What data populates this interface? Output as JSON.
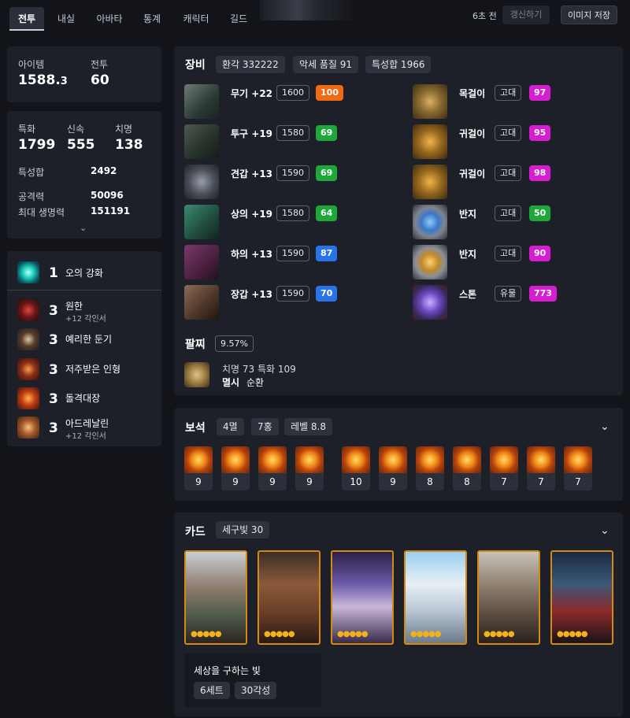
{
  "tabs": [
    "전투",
    "내실",
    "아바타",
    "통계",
    "캐릭터",
    "길드"
  ],
  "header": {
    "ago": "6초 전",
    "refresh": "갱신하기",
    "save": "이미지 저장"
  },
  "summary": {
    "item_label": "아이템",
    "item_level_main": "1588.",
    "item_level_sub": "3",
    "power_label": "전투",
    "power": "60"
  },
  "stats": {
    "crit_label": "특화",
    "crit": "1799",
    "swift_label": "신속",
    "swift": "555",
    "critical_label": "치명",
    "critical": "138",
    "total_label": "특성합",
    "total": "2492",
    "atk_label": "공격력",
    "atk": "50096",
    "hp_label": "최대 생명력",
    "hp": "151191"
  },
  "engravings": [
    {
      "level": "1",
      "name": "오의 강화",
      "sub": ""
    },
    {
      "level": "3",
      "name": "원한",
      "sub": "+12 각인서"
    },
    {
      "level": "3",
      "name": "예리한 둔기",
      "sub": ""
    },
    {
      "level": "3",
      "name": "저주받은 인형",
      "sub": ""
    },
    {
      "level": "3",
      "name": "돌격대장",
      "sub": ""
    },
    {
      "level": "3",
      "name": "아드레날린",
      "sub": "+12 각인서"
    }
  ],
  "equipment": {
    "title": "장비",
    "chips": [
      "환각 332222",
      "악세 품질 91",
      "특성합 1966"
    ],
    "left": [
      {
        "name": "무기 +22",
        "level": "1600",
        "quality": "100"
      },
      {
        "name": "투구 +19",
        "level": "1580",
        "quality": "69"
      },
      {
        "name": "견갑 +13",
        "level": "1590",
        "quality": "69"
      },
      {
        "name": "상의 +19",
        "level": "1580",
        "quality": "64"
      },
      {
        "name": "하의 +13",
        "level": "1590",
        "quality": "87"
      },
      {
        "name": "장갑 +13",
        "level": "1590",
        "quality": "70"
      }
    ],
    "right": [
      {
        "name": "목걸이",
        "grade": "고대",
        "quality": "97"
      },
      {
        "name": "귀걸이",
        "grade": "고대",
        "quality": "95"
      },
      {
        "name": "귀걸이",
        "grade": "고대",
        "quality": "98"
      },
      {
        "name": "반지",
        "grade": "고대",
        "quality": "50"
      },
      {
        "name": "반지",
        "grade": "고대",
        "quality": "90"
      },
      {
        "name": "스톤",
        "grade": "유물",
        "quality": "773"
      }
    ],
    "bracelet_label": "팔찌",
    "bracelet_pct": "9.57%",
    "bracelet_line1": "치명 73  특화 109",
    "bracelet_line2_a": "멸시",
    "bracelet_line2_b": "순환"
  },
  "gems": {
    "title": "보석",
    "chips": [
      "4멸",
      "7홍",
      "레벨 8.8"
    ],
    "levels": [
      "9",
      "9",
      "9",
      "9",
      "10",
      "9",
      "8",
      "8",
      "7",
      "7",
      "7"
    ]
  },
  "cards": {
    "title": "카드",
    "chip": "세구빛 30",
    "set_name": "세상을 구하는 빛",
    "set_chips": [
      "6세트",
      "30각성"
    ],
    "awaken_stars": "●●●●●"
  },
  "colors": {
    "q_orange": "#ef6a12",
    "q_green": "#1ea83a",
    "q_blue": "#2874e6",
    "q_magenta": "#d51ed0"
  }
}
